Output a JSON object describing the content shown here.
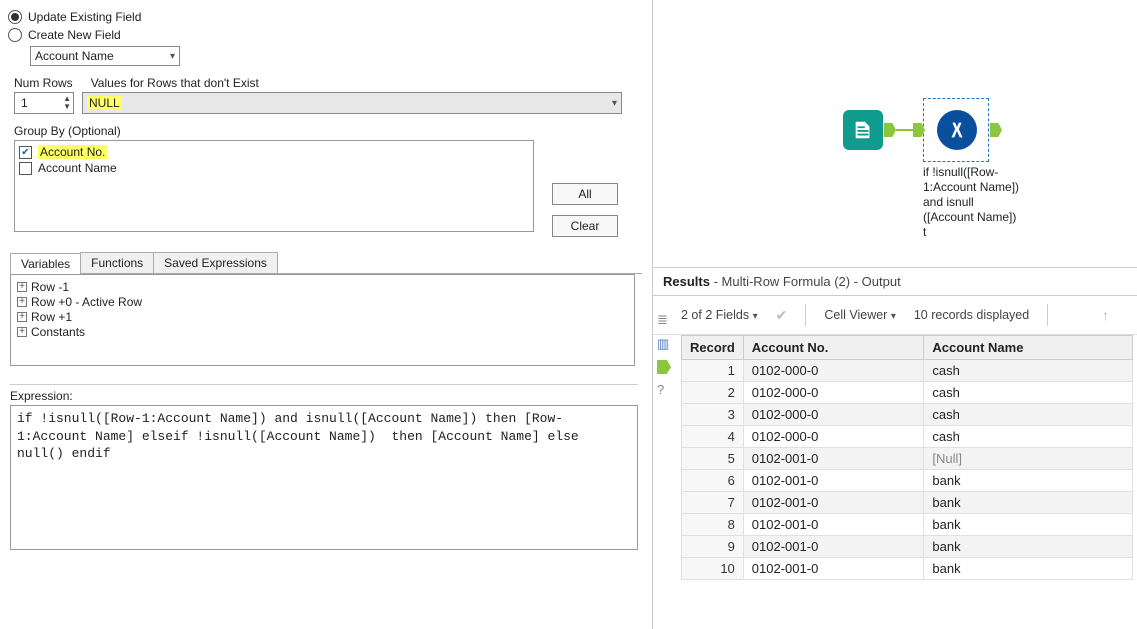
{
  "radios": {
    "update_label": "Update Existing Field",
    "create_label": "Create New  Field"
  },
  "field_select": {
    "value": "Account Name"
  },
  "numrows": {
    "label": "Num Rows",
    "value": "1"
  },
  "values_missing": {
    "label": "Values for Rows that don't Exist",
    "value": "NULL"
  },
  "groupby": {
    "label": "Group By (Optional)",
    "items": [
      {
        "label": "Account No.",
        "checked": true,
        "hl": true
      },
      {
        "label": "Account Name",
        "checked": false,
        "hl": false
      }
    ],
    "btn_all": "All",
    "btn_clear": "Clear"
  },
  "tabs": {
    "variables": "Variables",
    "functions": "Functions",
    "saved": "Saved Expressions"
  },
  "vars_tree": [
    "Row -1",
    "Row +0 - Active Row",
    "Row +1",
    "Constants"
  ],
  "expression": {
    "label": "Expression:",
    "text": "if !isnull([Row-1:Account Name]) and isnull([Account Name]) then [Row-1:Account Name] elseif !isnull([Account Name])  then [Account Name] else null() endif"
  },
  "canvas": {
    "formula_caption": "if !isnull([Row-1:Account Name]) and isnull ([Account Name]) t"
  },
  "results": {
    "title": "Results",
    "subtitle": "- Multi-Row Formula (2) - Output",
    "fields_text": "2 of 2 Fields",
    "cellviewer": "Cell Viewer",
    "records_text": "10 records displayed",
    "columns": [
      "Record",
      "Account No.",
      "Account Name"
    ],
    "rows": [
      {
        "rec": "1",
        "acct": "0102-000-0",
        "name": "cash"
      },
      {
        "rec": "2",
        "acct": "0102-000-0",
        "name": "cash"
      },
      {
        "rec": "3",
        "acct": "0102-000-0",
        "name": "cash"
      },
      {
        "rec": "4",
        "acct": "0102-000-0",
        "name": "cash"
      },
      {
        "rec": "5",
        "acct": "0102-001-0",
        "name": "[Null]"
      },
      {
        "rec": "6",
        "acct": "0102-001-0",
        "name": "bank"
      },
      {
        "rec": "7",
        "acct": "0102-001-0",
        "name": "bank"
      },
      {
        "rec": "8",
        "acct": "0102-001-0",
        "name": "bank"
      },
      {
        "rec": "9",
        "acct": "0102-001-0",
        "name": "bank"
      },
      {
        "rec": "10",
        "acct": "0102-001-0",
        "name": "bank"
      }
    ]
  }
}
